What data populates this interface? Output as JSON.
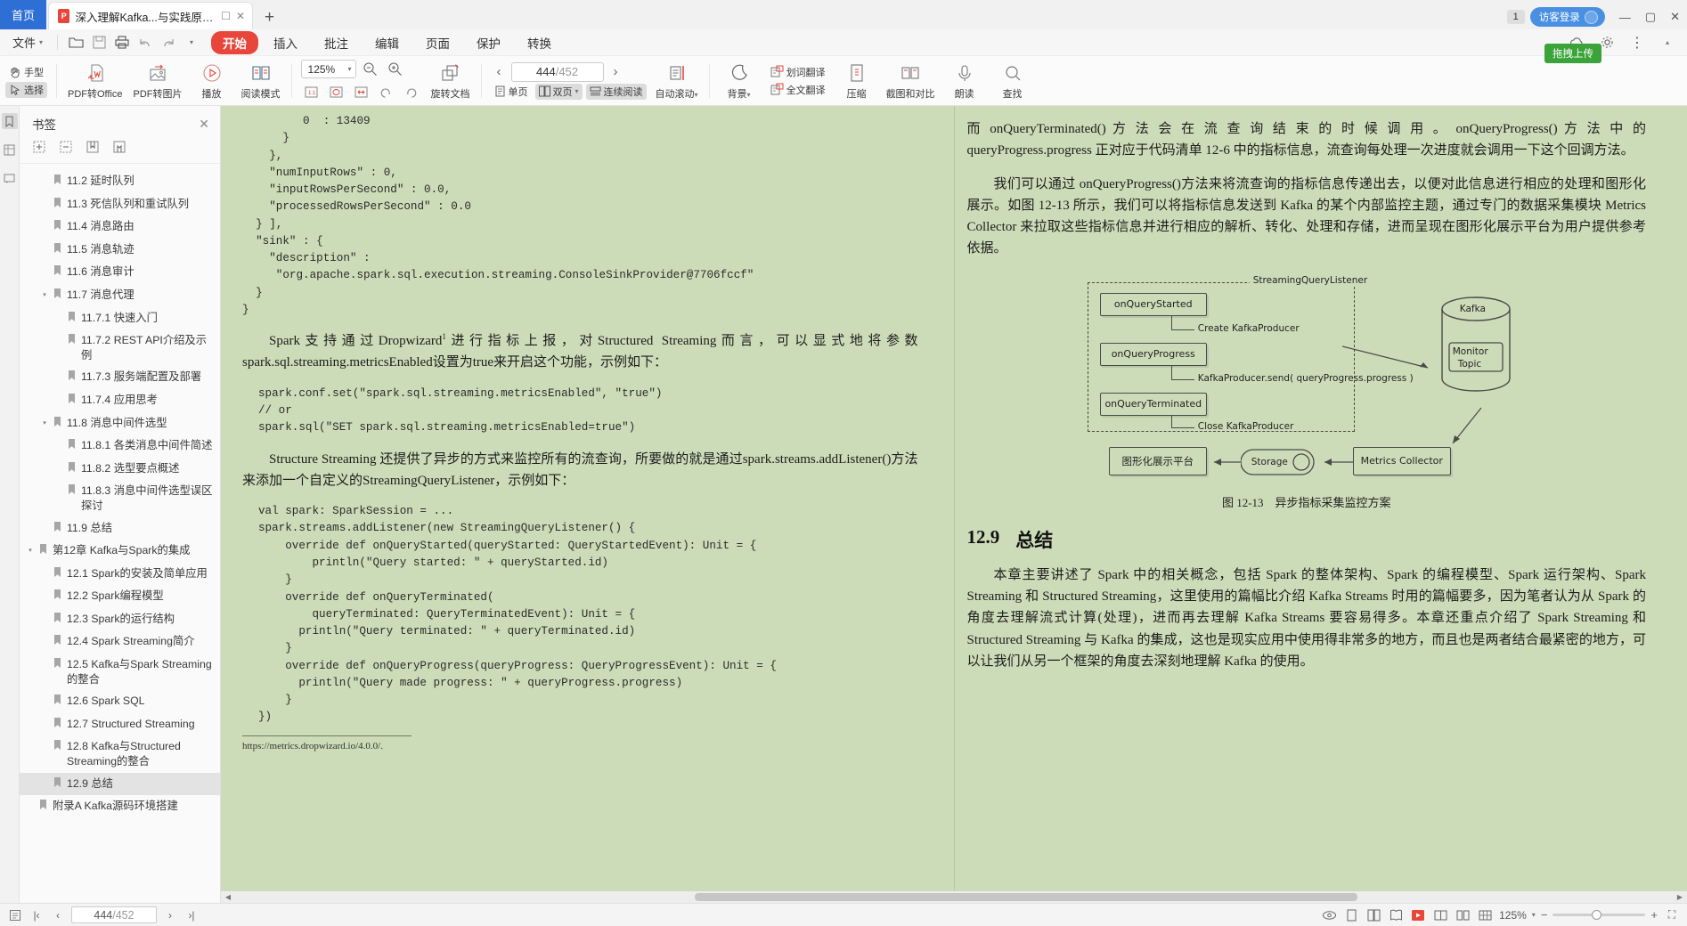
{
  "window": {
    "home_tab": "首页",
    "doc_tab_title": "深入理解Kafka...与实践原理.pdf",
    "pdf_badge": "P",
    "new_tab": "+",
    "count_badge": "1",
    "login_label": "访客登录",
    "minimize": "—",
    "maximize": "▢",
    "close": "✕"
  },
  "menu": {
    "file": "文件",
    "quick_icons": [
      "open-icon",
      "save-icon",
      "print-icon",
      "undo-icon",
      "redo-icon",
      "customize-caret-icon"
    ],
    "tabs": [
      {
        "label": "开始",
        "active": true
      },
      {
        "label": "插入",
        "active": false
      },
      {
        "label": "批注",
        "active": false
      },
      {
        "label": "编辑",
        "active": false
      },
      {
        "label": "页面",
        "active": false
      },
      {
        "label": "保护",
        "active": false
      },
      {
        "label": "转换",
        "active": false
      }
    ],
    "upload_pill": "拖拽上传"
  },
  "ribbon": {
    "hand_label": "手型",
    "select_label": "选择",
    "items": [
      {
        "label": "PDF转Office",
        "icon": "pdf-to-office-icon",
        "caret": true
      },
      {
        "label": "PDF转图片",
        "icon": "pdf-to-image-icon",
        "caret": false
      },
      {
        "label": "播放",
        "icon": "play-icon",
        "caret": false
      },
      {
        "label": "阅读模式",
        "icon": "read-mode-icon",
        "caret": false
      }
    ],
    "zoom_value": "125%",
    "zoom_out": "zoom-out-icon",
    "zoom_in": "zoom-in-icon",
    "fit_actual": "1:1",
    "fit_page": "fit-page-icon",
    "fit_width": "fit-width-icon",
    "rotate_left": "rotate-left-icon",
    "rotate_right": "rotate-right-icon",
    "rotate_label": "旋转文档",
    "page_prev": "‹",
    "page_next": "›",
    "page_current": "444",
    "page_total": "/452",
    "view_single": "单页",
    "view_double": "双页",
    "view_continuous": "连续阅读",
    "auto_scroll": "自动滚动",
    "background": "背景",
    "right_items": [
      {
        "label": "划词翻译",
        "icon": "word-translate-icon"
      },
      {
        "label": "全文翻译",
        "icon": "full-translate-icon"
      },
      {
        "label": "压缩",
        "icon": "compress-icon"
      },
      {
        "label": "截图和对比",
        "icon": "screenshot-compare-icon"
      },
      {
        "label": "朗读",
        "icon": "read-aloud-icon"
      },
      {
        "label": "查找",
        "icon": "find-icon"
      }
    ]
  },
  "sidebar": {
    "title": "书签",
    "close": "✕",
    "tools": [
      "expand-all-icon",
      "collapse-all-icon",
      "add-bookmark-icon",
      "delete-bookmark-icon"
    ],
    "items": [
      {
        "label": "11.2 延时队列",
        "indent": 1,
        "twisty": "",
        "selected": false
      },
      {
        "label": "11.3 死信队列和重试队列",
        "indent": 1,
        "twisty": "",
        "selected": false
      },
      {
        "label": "11.4 消息路由",
        "indent": 1,
        "twisty": "",
        "selected": false
      },
      {
        "label": "11.5 消息轨迹",
        "indent": 1,
        "twisty": "",
        "selected": false
      },
      {
        "label": "11.6 消息审计",
        "indent": 1,
        "twisty": "",
        "selected": false
      },
      {
        "label": "11.7 消息代理",
        "indent": 1,
        "twisty": "▾",
        "selected": false
      },
      {
        "label": "11.7.1 快速入门",
        "indent": 2,
        "twisty": "",
        "selected": false
      },
      {
        "label": "11.7.2 REST API介绍及示例",
        "indent": 2,
        "twisty": "",
        "selected": false
      },
      {
        "label": "11.7.3 服务端配置及部署",
        "indent": 2,
        "twisty": "",
        "selected": false
      },
      {
        "label": "11.7.4 应用思考",
        "indent": 2,
        "twisty": "",
        "selected": false
      },
      {
        "label": "11.8 消息中间件选型",
        "indent": 1,
        "twisty": "▾",
        "selected": false
      },
      {
        "label": "11.8.1 各类消息中间件简述",
        "indent": 2,
        "twisty": "",
        "selected": false
      },
      {
        "label": "11.8.2 选型要点概述",
        "indent": 2,
        "twisty": "",
        "selected": false
      },
      {
        "label": "11.8.3 消息中间件选型误区探讨",
        "indent": 2,
        "twisty": "",
        "selected": false
      },
      {
        "label": "11.9 总结",
        "indent": 1,
        "twisty": "",
        "selected": false
      },
      {
        "label": "第12章 Kafka与Spark的集成",
        "indent": 0,
        "twisty": "▾",
        "selected": false
      },
      {
        "label": "12.1 Spark的安装及简单应用",
        "indent": 1,
        "twisty": "",
        "selected": false
      },
      {
        "label": "12.2 Spark编程模型",
        "indent": 1,
        "twisty": "",
        "selected": false
      },
      {
        "label": "12.3 Spark的运行结构",
        "indent": 1,
        "twisty": "",
        "selected": false
      },
      {
        "label": "12.4 Spark Streaming简介",
        "indent": 1,
        "twisty": "",
        "selected": false
      },
      {
        "label": "12.5 Kafka与Spark Streaming的整合",
        "indent": 1,
        "twisty": "",
        "selected": false
      },
      {
        "label": "12.6 Spark SQL",
        "indent": 1,
        "twisty": "",
        "selected": false
      },
      {
        "label": "12.7 Structured Streaming",
        "indent": 1,
        "twisty": "",
        "selected": false
      },
      {
        "label": "12.8 Kafka与Structured Streaming的整合",
        "indent": 1,
        "twisty": "",
        "selected": false
      },
      {
        "label": "12.9 总结",
        "indent": 1,
        "twisty": "",
        "selected": true
      },
      {
        "label": "附录A Kafka源码环境搭建",
        "indent": 0,
        "twisty": "",
        "selected": false
      }
    ]
  },
  "document": {
    "left_page": {
      "code_top": "         0  : 13409\n      }\n    },\n    \"numInputRows\" : 0,\n    \"inputRowsPerSecond\" : 0.0,\n    \"processedRowsPerSecond\" : 0.0\n  } ],\n  \"sink\" : {\n    \"description\" :\n     \"org.apache.spark.sql.execution.streaming.ConsoleSinkProvider@7706fccf\"\n  }\n}",
      "para1_a": "Spark支持通过Dropwizard",
      "para1_sup": "1",
      "para1_b": "进行指标上报，对Structured Streaming而言，可以显式地将参数",
      "para1_c": "spark.sql.streaming.metricsEnabled设置为true来开启这个功能，示例如下：",
      "code_mid": "spark.conf.set(\"spark.sql.streaming.metricsEnabled\", \"true\")\n// or\nspark.sql(\"SET spark.sql.streaming.metricsEnabled=true\")",
      "para2": "Structure Streaming 还提供了异步的方式来监控所有的流查询，所要做的就是通过spark.streams.addListener()方法来添加一个自定义的StreamingQueryListener，示例如下：",
      "code_bottom": "val spark: SparkSession = ...\nspark.streams.addListener(new StreamingQueryListener() {\n    override def onQueryStarted(queryStarted: QueryStartedEvent): Unit = {\n        println(\"Query started: \" + queryStarted.id)\n    }\n    override def onQueryTerminated(\n        queryTerminated: QueryTerminatedEvent): Unit = {\n      println(\"Query terminated: \" + queryTerminated.id)\n    }\n    override def onQueryProgress(queryProgress: QueryProgressEvent): Unit = {\n      println(\"Query made progress: \" + queryProgress.progress)\n    }\n})",
      "footnote": "https://metrics.dropwizard.io/4.0.0/."
    },
    "right_page": {
      "para1": "而 onQueryTerminated() 方 法 会 在 流 查 询 结 束 的 时 候 调 用 。 onQueryProgress() 方 法 中 的 queryProgress.progress 正对应于代码清单 12-6 中的指标信息，流查询每处理一次进度就会调用一下这个回调方法。",
      "para2": "我们可以通过 onQueryProgress()方法来将流查询的指标信息传递出去，以便对此信息进行相应的处理和图形化展示。如图 12-13 所示，我们可以将指标信息发送到 Kafka 的某个内部监控主题，通过专门的数据采集模块 Metrics Collector 来拉取这些指标信息并进行相应的解析、转化、处理和存储，进而呈现在图形化展示平台为用户提供参考依据。",
      "figure": {
        "group_label": "StreamingQueryListener",
        "boxes": [
          "onQueryStarted",
          "onQueryProgress",
          "onQueryTerminated"
        ],
        "branch_labels": [
          "Create KafkaProducer",
          "KafkaProducer.send( queryProgress.progress )",
          "Close KafkaProducer"
        ],
        "kafka_label": "Kafka",
        "topic_label_1": "Monitor",
        "topic_label_2": "Topic",
        "display_platform": "图形化展示平台",
        "storage": "Storage",
        "collector": "Metrics Collector",
        "caption_no": "图 12-13",
        "caption_text": "异步指标采集监控方案"
      },
      "section_no": "12.9",
      "section_title": "总结",
      "para3": "本章主要讲述了 Spark 中的相关概念，包括 Spark 的整体架构、Spark 的编程模型、Spark 运行架构、Spark Streaming 和 Structured Streaming，这里使用的篇幅比介绍 Kafka Streams 时用的篇幅要多，因为笔者认为从 Spark 的角度去理解流式计算(处理)，进而再去理解 Kafka Streams 要容易得多。本章还重点介绍了 Spark Streaming 和 Structured Streaming 与 Kafka 的集成，这也是现实应用中使用得非常多的地方，而且也是两者结合最紧密的地方，可以让我们从另一个框架的角度去深刻地理解 Kafka 的使用。"
    }
  },
  "status": {
    "page_current": "444",
    "page_total": "/452",
    "first": "|‹",
    "prev": "‹",
    "next": "›",
    "last": "›|",
    "thumbnail_icon": "thumbnail-icon",
    "zoom_value": "125%",
    "zoom_out": "−",
    "zoom_in": "+",
    "fullscreen": "⛶",
    "icons_left": [
      "note-icon"
    ],
    "icons_right": [
      "eye-icon",
      "single-page-icon",
      "facing-page-icon",
      "book-icon",
      "present-icon",
      "split-icon",
      "compare-icon",
      "grid-icon"
    ]
  }
}
